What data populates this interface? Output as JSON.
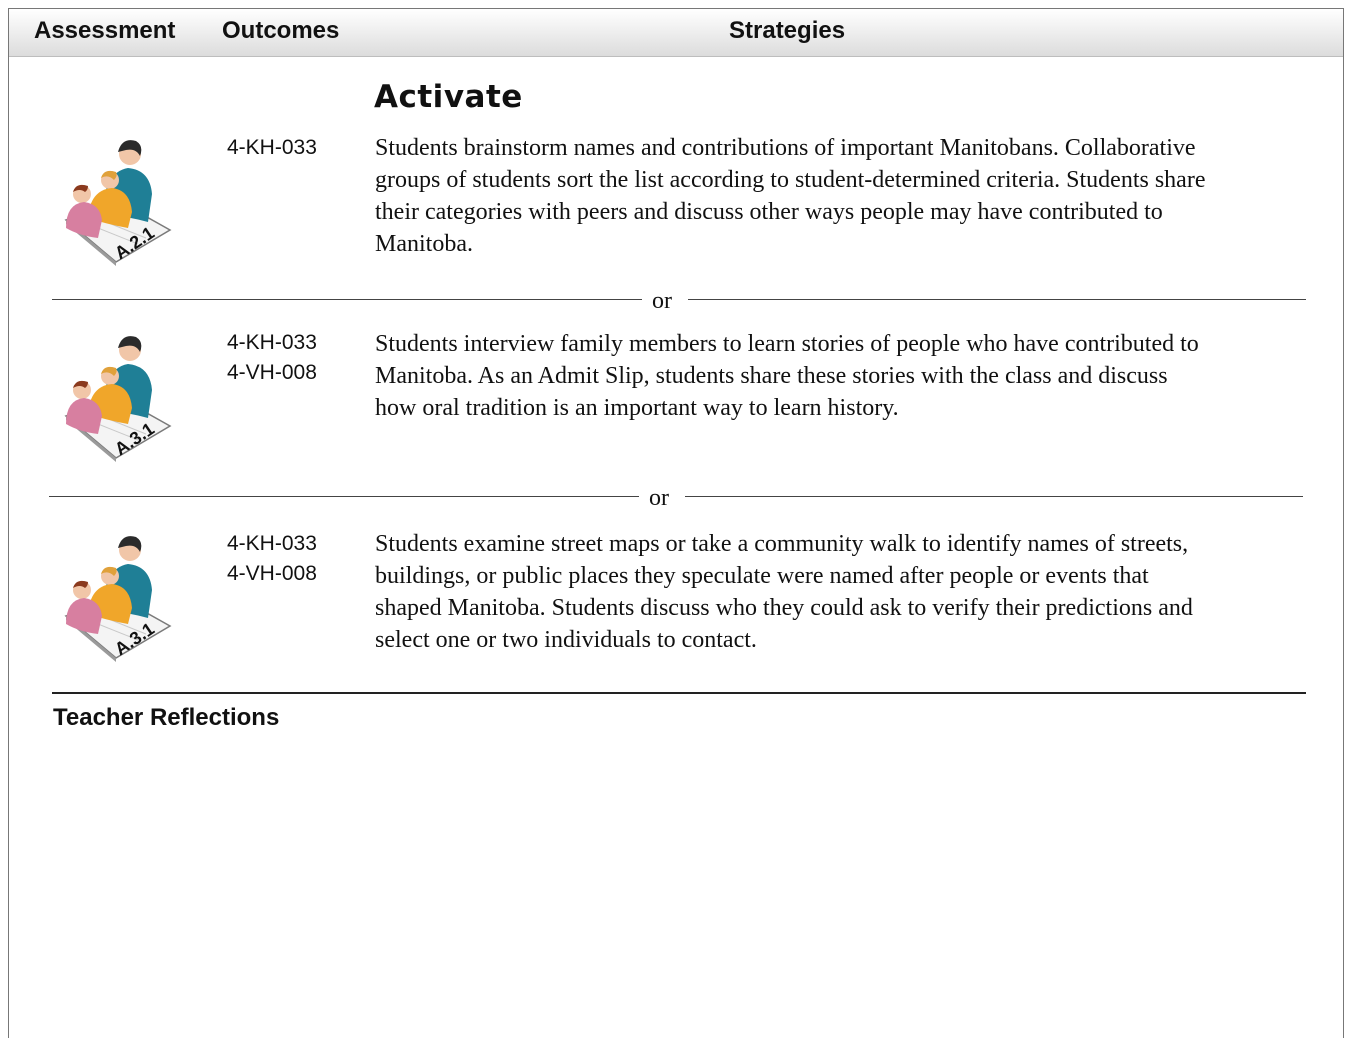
{
  "header": {
    "assessment": "Assessment",
    "outcomes": "Outcomes",
    "strategies": "Strategies"
  },
  "section_title": "Activate",
  "separator_label": "or",
  "entries": [
    {
      "badge": "A.2.1",
      "outcomes": [
        "4-KH-033"
      ],
      "lines": [
        "Students brainstorm names and contributions of important Manitobans. Collaborative",
        "groups of students sort the list according to student-determined criteria. Students share",
        "their categories with peers and discuss other ways people may have contributed to",
        "Manitoba."
      ]
    },
    {
      "badge": "A.3.1",
      "outcomes": [
        "4-KH-033",
        "4-VH-008"
      ],
      "lines": [
        "Students interview family members to learn stories of people who have contributed to",
        "Manitoba. As an Admit Slip, students share these stories with the class and discuss",
        "how oral tradition is an important way to learn history."
      ]
    },
    {
      "badge": "A.3.1",
      "outcomes": [
        "4-KH-033",
        "4-VH-008"
      ],
      "lines": [
        "Students examine street maps or take a community walk to identify names of streets,",
        "buildings, or public places they speculate were named after people or events that",
        "shaped Manitoba. Students discuss who they could ask to verify their predictions and",
        "select one or two individuals to contact."
      ]
    }
  ],
  "reflections_title": "Teacher Reflections",
  "icon": "teacher-student-assessment-icon"
}
